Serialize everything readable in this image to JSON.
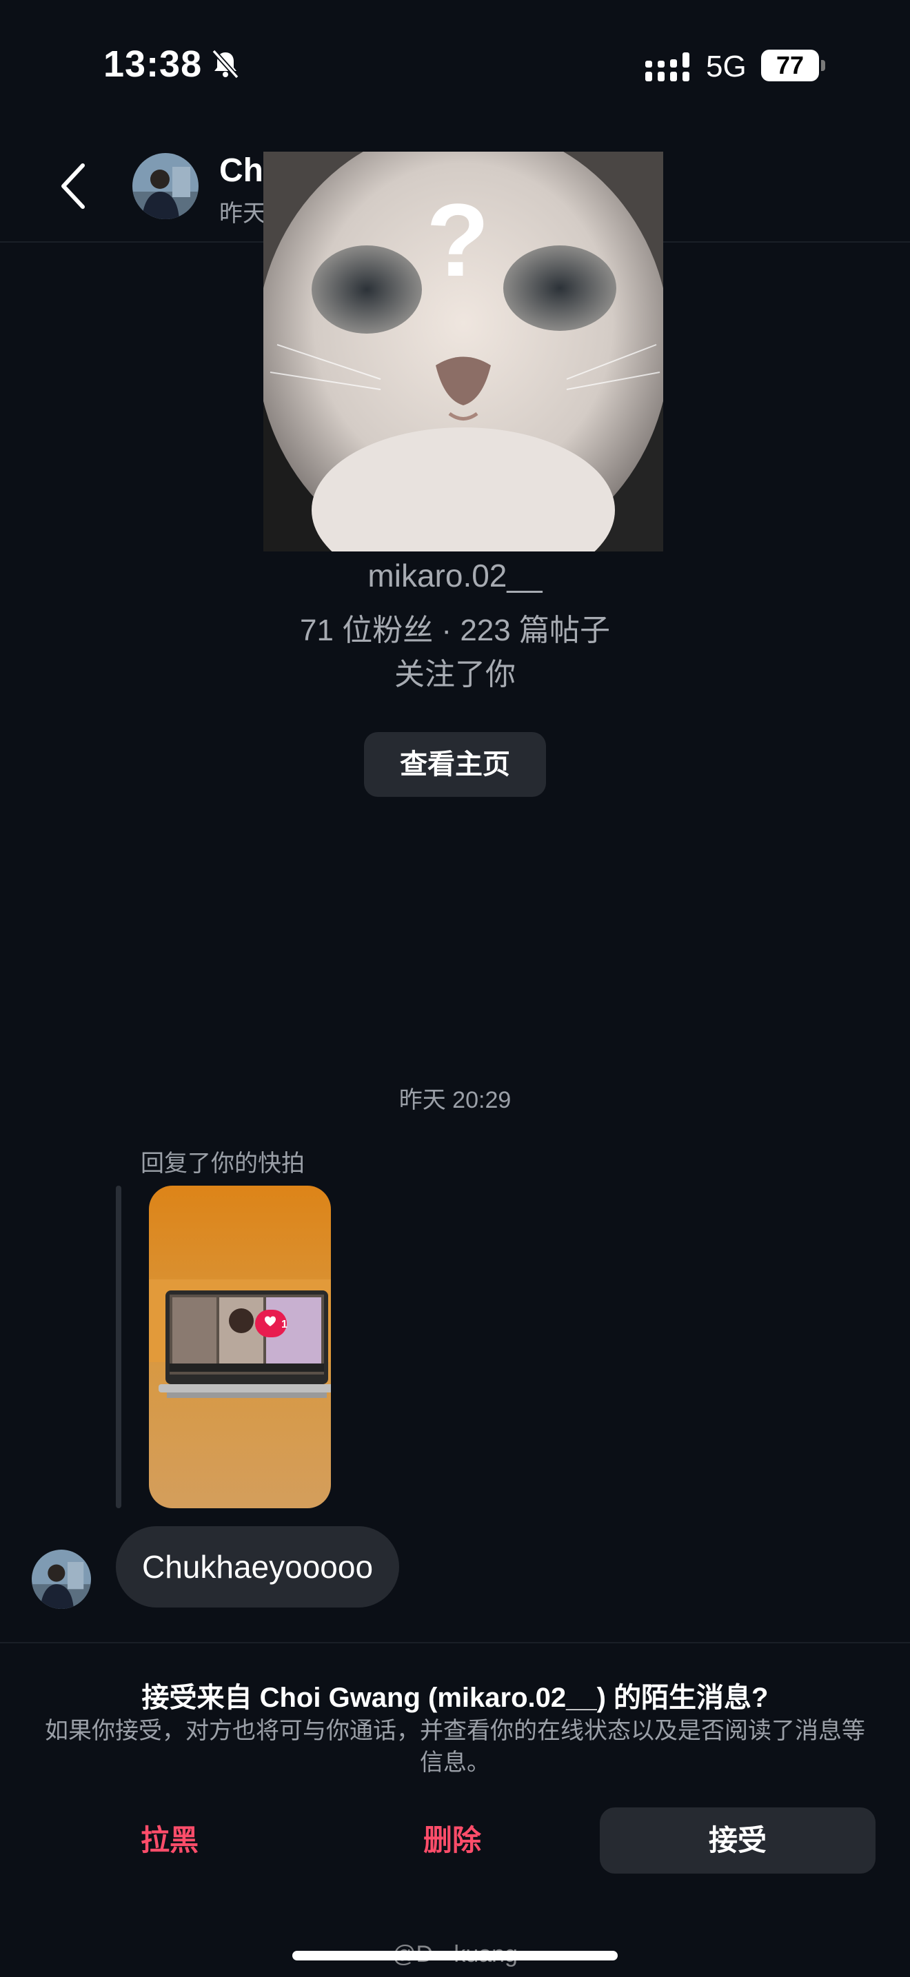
{
  "status_bar": {
    "time": "13:38",
    "mute_icon": "bell-slash-icon",
    "network": "5G",
    "battery": "77"
  },
  "header": {
    "name": "Ch",
    "subtitle": "昨天"
  },
  "profile": {
    "username": "mikaro.02__",
    "stats": "71 位粉丝 · 223 篇帖子",
    "follow_status": "关注了你",
    "view_profile_label": "查看主页"
  },
  "chat": {
    "timestamp": "昨天 20:29",
    "reply_label": "回复了你的快拍",
    "snap_like_count": "1",
    "message_text": "Chukhaeyooooo"
  },
  "request": {
    "title": "接受来自 Choi Gwang (mikaro.02__) 的陌生消息?",
    "description": "如果你接受，对方也将可与你通话，并查看你的在线状态以及是否阅读了消息等信息。",
    "block_label": "拉黑",
    "delete_label": "删除",
    "accept_label": "接受"
  },
  "watermark": "@D - kuang",
  "colors": {
    "background": "#0b0f16",
    "surface": "#262a31",
    "danger": "#ff4d6a",
    "muted_text": "#9ba0a8"
  }
}
